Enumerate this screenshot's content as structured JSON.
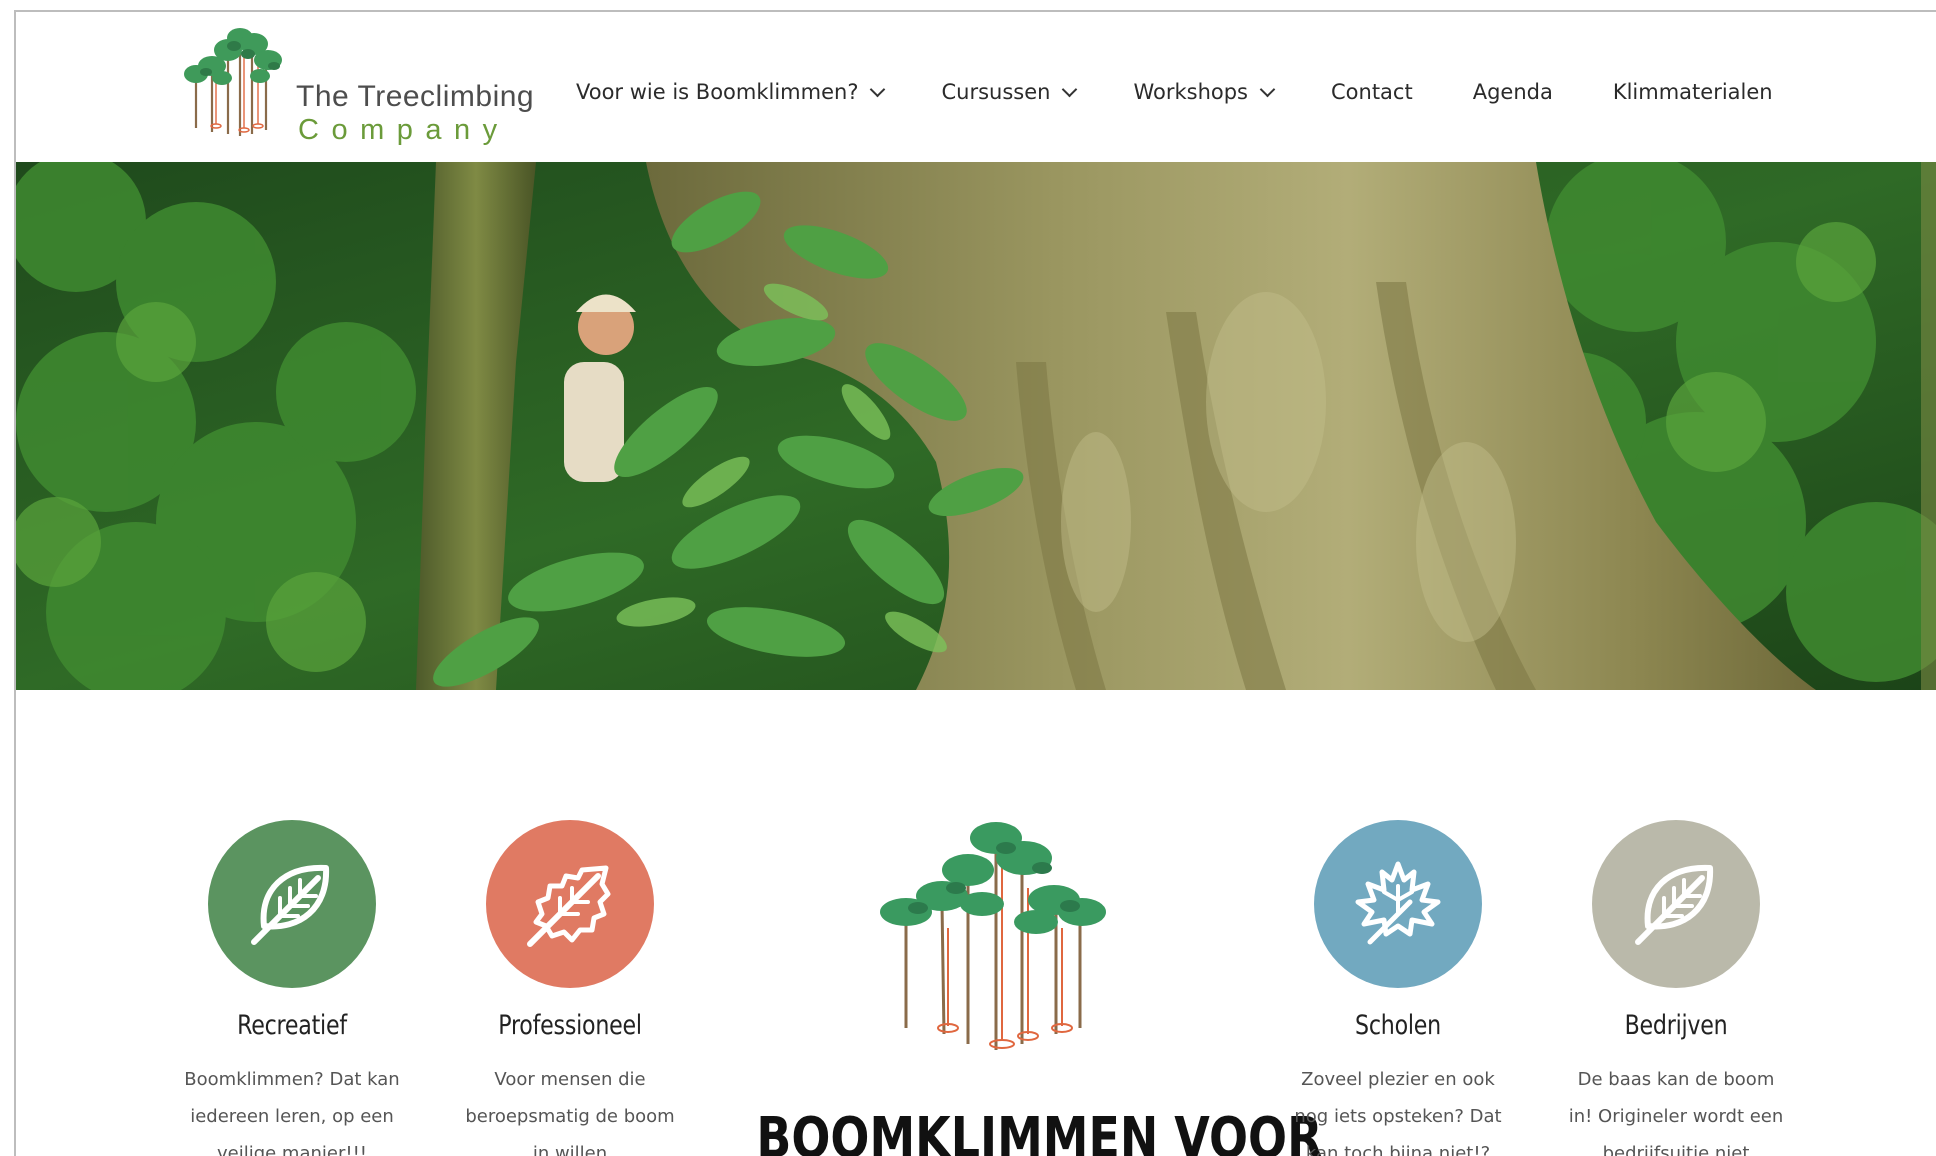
{
  "logo": {
    "line1": "The Treeclimbing",
    "line2": "Company"
  },
  "nav": {
    "items": [
      {
        "label": "Voor wie is Boomklimmen?",
        "dropdown": true,
        "icon": "chevron-down-icon"
      },
      {
        "label": "Cursussen",
        "dropdown": true,
        "icon": "chevron-down-icon"
      },
      {
        "label": "Workshops",
        "dropdown": true,
        "icon": "chevron-down-icon"
      },
      {
        "label": "Contact",
        "dropdown": false
      },
      {
        "label": "Agenda",
        "dropdown": false
      },
      {
        "label": "Klimmaterialen",
        "dropdown": false
      }
    ]
  },
  "features": [
    {
      "title": "Recreatief",
      "text": "Boomklimmen? Dat kan iedereen leren, op een veilige manier!!!",
      "color": "#5b9460",
      "icon": "leaf-icon"
    },
    {
      "title": "Professioneel",
      "text": "Voor mensen die beroepsmatig de boom in willen",
      "color": "#e07a63",
      "icon": "oak-leaf-icon"
    },
    {
      "title": "Scholen",
      "text": "Zoveel plezier en ook nog iets opsteken? Dat kan toch bijna niet!?",
      "color": "#72a9c0",
      "icon": "maple-leaf-icon"
    },
    {
      "title": "Bedrijven",
      "text": "De baas kan de boom in! Origineler wordt een bedrijfsuitje niet",
      "color": "#bab9aa",
      "icon": "leaf-icon"
    }
  ],
  "center": {
    "title": "BOOMKLIMMEN VOOR",
    "icon": "tree-group-icon"
  },
  "colors": {
    "logo_green": "#6b9b3a",
    "logo_gray": "#4d4d4d",
    "tree_green": "#3a8f5a",
    "rope_orange": "#e0673f"
  }
}
